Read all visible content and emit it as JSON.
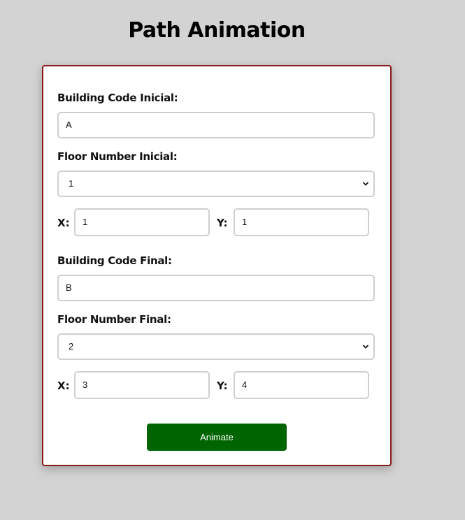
{
  "page": {
    "title": "Path Animation"
  },
  "form": {
    "initial": {
      "building_label": "Building Code Inicial:",
      "building_value": "A",
      "floor_label": "Floor Number Inicial:",
      "floor_value": "1",
      "x_label": "X:",
      "x_value": "1",
      "y_label": "Y:",
      "y_value": "1"
    },
    "final": {
      "building_label": "Building Code Final:",
      "building_value": "B",
      "floor_label": "Floor Number Final:",
      "floor_value": "2",
      "x_label": "X:",
      "x_value": "3",
      "y_label": "Y:",
      "y_value": "4"
    },
    "animate_label": "Animate"
  },
  "colors": {
    "background": "#d3d3d3",
    "card_border": "#8b1a1a",
    "button": "#006400",
    "input_border": "#cfcfcf"
  },
  "icons": {
    "select_arrow": "chevron-down-icon"
  }
}
